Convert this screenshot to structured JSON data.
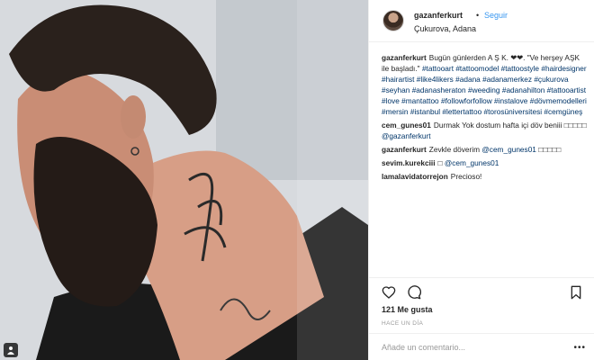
{
  "post": {
    "username": "gazanferkurt",
    "separator": "•",
    "follow_label": "Seguir",
    "location": "Çukurova, Adana",
    "caption_user": "gazanferkurt",
    "caption_text": "Bugün günlerden A Ş K. ❤❤. \"Ve herşey AŞK ile başladı.\"",
    "hashtags": [
      "#tattooart",
      "#tattoomodel",
      "#tattoostyle",
      "#hairdesigner",
      "#hairartist",
      "#like4likers",
      "#adana",
      "#adanamerkez",
      "#çukurova",
      "#seyhan",
      "#adanasheraton",
      "#weeding",
      "#adanahilton",
      "#tattooartist",
      "#love",
      "#mantattoo",
      "#followforfollow",
      "#instalove",
      "#dövmemodelleri",
      "#mersin",
      "#istanbul",
      "#lettertattoo",
      "#torosüniversitesi",
      "#cemgüneş"
    ],
    "comments": [
      {
        "user": "cem_gunes01",
        "text": "Durmak Yok dostum hafta içi döv beniii □□□□□",
        "mention": "@gazanferkurt"
      },
      {
        "user": "gazanferkurt",
        "text": "Zevkle döverim",
        "mention": "@cem_gunes01",
        "suffix": "□□□□□"
      },
      {
        "user": "sevim.kurekciii",
        "text": "□",
        "mention": "@cem_gunes01"
      },
      {
        "user": "lamalavidatorrejon",
        "text": "Precioso!"
      }
    ],
    "likes": "121 Me gusta",
    "time_ago": "HACE UN DÍA",
    "comment_placeholder": "Añade un comentario...",
    "more_label": "•••"
  },
  "icons": {
    "like": "heart-icon",
    "comment": "comment-icon",
    "save": "bookmark-icon",
    "photo_corner": "person-icon"
  },
  "colors": {
    "link": "#3897f0",
    "hashtag": "#003569",
    "muted": "#999999",
    "border": "#efefef"
  }
}
